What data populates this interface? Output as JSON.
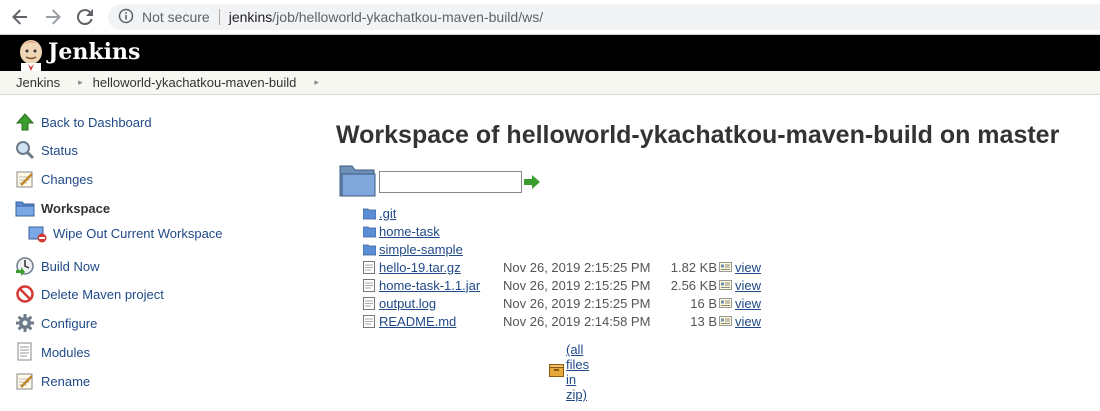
{
  "browser": {
    "not_secure": "Not secure",
    "url_host": "jenkins",
    "url_path": "/job/helloworld-ykachatkou-maven-build/ws/"
  },
  "header": {
    "logo_text": "Jenkins"
  },
  "breadcrumbs": [
    {
      "label": "Jenkins"
    },
    {
      "label": "helloworld-ykachatkou-maven-build"
    }
  ],
  "sidebar": {
    "items": [
      {
        "label": "Back to Dashboard",
        "icon": "up-arrow-icon"
      },
      {
        "label": "Status",
        "icon": "search-icon"
      },
      {
        "label": "Changes",
        "icon": "notepad-icon"
      },
      {
        "label": "Workspace",
        "icon": "folder-icon"
      },
      {
        "label": "Wipe Out Current Workspace",
        "icon": "wipe-folder-icon"
      },
      {
        "label": "Build Now",
        "icon": "clock-icon"
      },
      {
        "label": "Delete Maven project",
        "icon": "no-entry-icon"
      },
      {
        "label": "Configure",
        "icon": "gear-icon"
      },
      {
        "label": "Modules",
        "icon": "document-icon"
      },
      {
        "label": "Rename",
        "icon": "notepad-icon"
      }
    ]
  },
  "main": {
    "title": "Workspace of helloworld-ykachatkou-maven-build on master",
    "path_input_value": "",
    "folders": [
      ".git",
      "home-task",
      "simple-sample"
    ],
    "files": [
      {
        "name": "hello-19.tar.gz",
        "date": "Nov 26, 2019 2:15:25 PM",
        "size": "1.82 KB",
        "view": "view"
      },
      {
        "name": "home-task-1.1.jar",
        "date": "Nov 26, 2019 2:15:25 PM",
        "size": "2.56 KB",
        "view": "view"
      },
      {
        "name": "output.log",
        "date": "Nov 26, 2019 2:15:25 PM",
        "size": "16 B",
        "view": "view"
      },
      {
        "name": "README.md",
        "date": "Nov 26, 2019 2:14:58 PM",
        "size": "13 B",
        "view": "view"
      }
    ],
    "zip_link": "(all files in zip)"
  },
  "colors": {
    "link": "#204a87",
    "header_bg": "#000000",
    "breadcrumb_bg": "#f7f7f1"
  }
}
